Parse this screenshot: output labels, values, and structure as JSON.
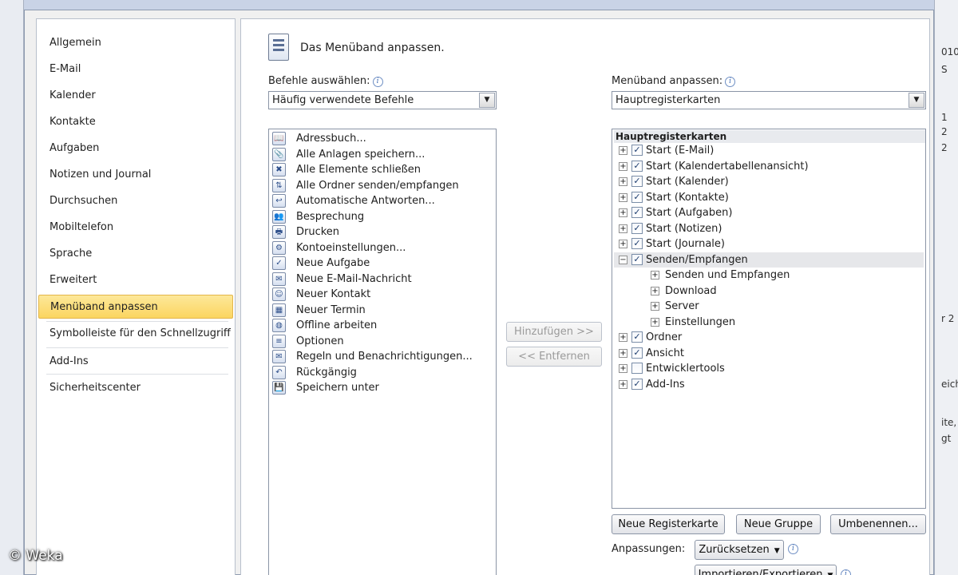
{
  "background": {
    "right_fragments": [
      "010",
      "S",
      "1",
      "2",
      "2",
      "r 2",
      "eich",
      "ite,",
      "gt"
    ],
    "watermark": "© Weka"
  },
  "nav": {
    "items": [
      {
        "label": "Allgemein"
      },
      {
        "label": "E-Mail"
      },
      {
        "label": "Kalender"
      },
      {
        "label": "Kontakte"
      },
      {
        "label": "Aufgaben"
      },
      {
        "label": "Notizen und Journal"
      },
      {
        "label": "Durchsuchen"
      },
      {
        "label": "Mobiltelefon"
      },
      {
        "label": "Sprache"
      },
      {
        "label": "Erweitert"
      },
      {
        "label": "Menüband anpassen",
        "selected": true
      },
      {
        "label": "Symbolleiste für den Schnellzugriff"
      },
      {
        "label": "Add-Ins"
      },
      {
        "label": "Sicherheitscenter"
      }
    ]
  },
  "header": {
    "title": "Das Menüband anpassen."
  },
  "commands": {
    "label": "Befehle auswählen:",
    "selected": "Häufig verwendete Befehle",
    "items": [
      {
        "label": "Adressbuch...",
        "icon": "address-book-icon",
        "glyph": "📖"
      },
      {
        "label": "Alle Anlagen speichern...",
        "icon": "save-attachments-icon",
        "glyph": "📎"
      },
      {
        "label": "Alle Elemente schließen",
        "icon": "close-all-icon",
        "glyph": "✖"
      },
      {
        "label": "Alle Ordner senden/empfangen",
        "icon": "send-receive-icon",
        "glyph": "⇅"
      },
      {
        "label": "Automatische Antworten...",
        "icon": "auto-reply-icon",
        "glyph": "↩"
      },
      {
        "label": "Besprechung",
        "icon": "meeting-icon",
        "glyph": "👥"
      },
      {
        "label": "Drucken",
        "icon": "print-icon",
        "glyph": "🖶"
      },
      {
        "label": "Kontoeinstellungen...",
        "icon": "account-settings-icon",
        "glyph": "⚙"
      },
      {
        "label": "Neue Aufgabe",
        "icon": "new-task-icon",
        "glyph": "✓"
      },
      {
        "label": "Neue E-Mail-Nachricht",
        "icon": "new-mail-icon",
        "glyph": "✉"
      },
      {
        "label": "Neuer Kontakt",
        "icon": "new-contact-icon",
        "glyph": "☺"
      },
      {
        "label": "Neuer Termin",
        "icon": "new-appointment-icon",
        "glyph": "▦"
      },
      {
        "label": "Offline arbeiten",
        "icon": "offline-globe-icon",
        "glyph": "◍"
      },
      {
        "label": "Optionen",
        "icon": "options-icon",
        "glyph": "≡"
      },
      {
        "label": "Regeln und Benachrichtigungen...",
        "icon": "rules-icon",
        "glyph": "✉"
      },
      {
        "label": "Rückgängig",
        "icon": "undo-icon",
        "glyph": "↶"
      },
      {
        "label": "Speichern unter",
        "icon": "save-as-icon",
        "glyph": "💾"
      }
    ]
  },
  "middle": {
    "add_label": "Hinzufügen >>",
    "remove_label": "<< Entfernen"
  },
  "ribbon": {
    "label": "Menüband anpassen:",
    "selected": "Hauptregisterkarten",
    "tree_header": "Hauptregisterkarten",
    "nodes": [
      {
        "label": "Start (E-Mail)",
        "level": 0,
        "expander": "+",
        "checked": true
      },
      {
        "label": "Start (Kalendertabellenansicht)",
        "level": 0,
        "expander": "+",
        "checked": true
      },
      {
        "label": "Start (Kalender)",
        "level": 0,
        "expander": "+",
        "checked": true
      },
      {
        "label": "Start (Kontakte)",
        "level": 0,
        "expander": "+",
        "checked": true
      },
      {
        "label": "Start (Aufgaben)",
        "level": 0,
        "expander": "+",
        "checked": true
      },
      {
        "label": "Start (Notizen)",
        "level": 0,
        "expander": "+",
        "checked": true
      },
      {
        "label": "Start (Journale)",
        "level": 0,
        "expander": "+",
        "checked": true
      },
      {
        "label": "Senden/Empfangen",
        "level": 0,
        "expander": "−",
        "checked": true,
        "selected": true
      },
      {
        "label": "Senden und Empfangen",
        "level": 1,
        "expander": "+"
      },
      {
        "label": "Download",
        "level": 1,
        "expander": "+"
      },
      {
        "label": "Server",
        "level": 1,
        "expander": "+"
      },
      {
        "label": "Einstellungen",
        "level": 1,
        "expander": "+"
      },
      {
        "label": "Ordner",
        "level": 0,
        "expander": "+",
        "checked": true
      },
      {
        "label": "Ansicht",
        "level": 0,
        "expander": "+",
        "checked": true
      },
      {
        "label": "Entwicklertools",
        "level": 0,
        "expander": "+",
        "checked": false
      },
      {
        "label": "Add-Ins",
        "level": 0,
        "expander": "+",
        "checked": true
      }
    ],
    "new_tab_label": "Neue Registerkarte",
    "new_group_label": "Neue Gruppe",
    "rename_label": "Umbenennen...",
    "customizations_label": "Anpassungen:",
    "reset_label": "Zurücksetzen",
    "import_export_label": "Importieren/Exportieren"
  }
}
